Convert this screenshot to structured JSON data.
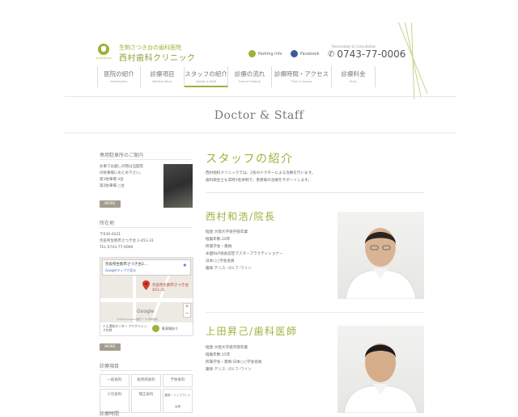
{
  "header": {
    "logo_small": "NISHIMURA",
    "clinic_sub": "生駒さつき台の歯科医院",
    "clinic_name": "西村歯科クリニック",
    "parking_link": "Parking info",
    "facebook_link": "Facebook",
    "reservation_note": "Reservation & Consultation",
    "phone": "0743-77-0006"
  },
  "nav": [
    {
      "jp": "医院の紹介",
      "en": "Introduction"
    },
    {
      "jp": "診療項目",
      "en": "Medical items"
    },
    {
      "jp": "スタッフの紹介",
      "en": "Doctor & Staff"
    },
    {
      "jp": "診療の流れ",
      "en": "Flow of medical"
    },
    {
      "jp": "診療時間・アクセス",
      "en": "Time & Access"
    },
    {
      "jp": "診療料金",
      "en": "Price"
    }
  ],
  "page_title": "Doctor & Staff",
  "sidebar": {
    "parking_heading": "専用駐車所のご案内",
    "parking_text": [
      "お車でお越しの際は当医院",
      "の駐車場におとめ下さい。",
      "第1駐車場 4台",
      "第2駐車場 ○台"
    ],
    "more_label": "MORE",
    "location_heading": "所在地",
    "address": [
      "〒630-0221",
      "奈良県生駒市さつき台 2-451-31",
      "TEL 0743-77-0006"
    ],
    "map_title": "奈良県生駒市さつき台2...",
    "map_link": "Googleマップで見る",
    "map_pin_label": "奈良県生駒市さつき台 451-31",
    "map_google": "Google",
    "map_copyright": "©2016 Google  地図データ  利用規約",
    "map_place_label": "人工透析センター アベクリニックの特",
    "parking_map_label": "駐車場あり",
    "treatment_heading": "診療項目",
    "treatment_items": [
      "一般歯科",
      "歯周病歯科",
      "予防歯科",
      "小児歯科",
      "矯正歯科",
      "審美・インプラント治療"
    ],
    "hours_heading": "診療時間"
  },
  "content": {
    "section_title": "スタッフの紹介",
    "intro": [
      "西村歯科クリニックでは、2名のドクターによる治療を行います。",
      "歯科衛生士も常時3名体制で、患者様の治療をサポートします。"
    ],
    "doctors": [
      {
        "name": "西村和浩/院長",
        "profile": [
          "経歴:大阪大学歯学部卒業",
          "経験年数:20年",
          "所属学会・資格:",
          "米国NLP協会認定マスタープラクティショナー",
          "日本○○学会会員",
          "趣味:テニス･ゴルフ･ワイン"
        ]
      },
      {
        "name": "上田昇己/歯科医師",
        "profile": [
          "経歴:大阪大学歯学部卒業",
          "経験年数:15年",
          "所属学会・資格:日本○○学会会員",
          "趣味:テニス･ゴルフ･ワイン"
        ]
      }
    ]
  },
  "colors": {
    "accent": "#9cb23a",
    "facebook": "#3b5998",
    "more_button": "#a39d8e"
  }
}
